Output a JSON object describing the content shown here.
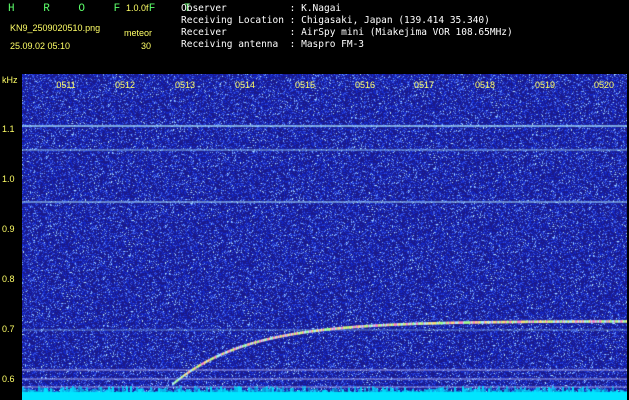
{
  "header": {
    "title": "H R O F F T",
    "version": "1.0.0f",
    "filename": "KN9_2509020510.png",
    "meteor_label": "meteor",
    "meteor_count": "30",
    "datetime": "25.09.02 05:10",
    "observer": "Observer           : K.Nagai",
    "location": "Receiving Location : Chigasaki, Japan (139.414 35.340)",
    "receiver": "Receiver           : AirSpy mini (Miakejima VOR 108.65MHz)",
    "antenna": "Receiving antenna  : Maspro FM-3"
  },
  "spectrogram": {
    "y_unit": "kHz",
    "time_ticks": [
      "0511",
      "0512",
      "0513",
      "0514",
      "0515",
      "0516",
      "0517",
      "0518",
      "0519",
      "0520"
    ],
    "freq_ticks": [
      "1.1",
      "1.0",
      "0.9",
      "0.8",
      "0.7",
      "0.6"
    ],
    "background_color": "#1a1a8c",
    "line_color": "#b8e0ff",
    "baseline_color": "#00e5ff"
  }
}
